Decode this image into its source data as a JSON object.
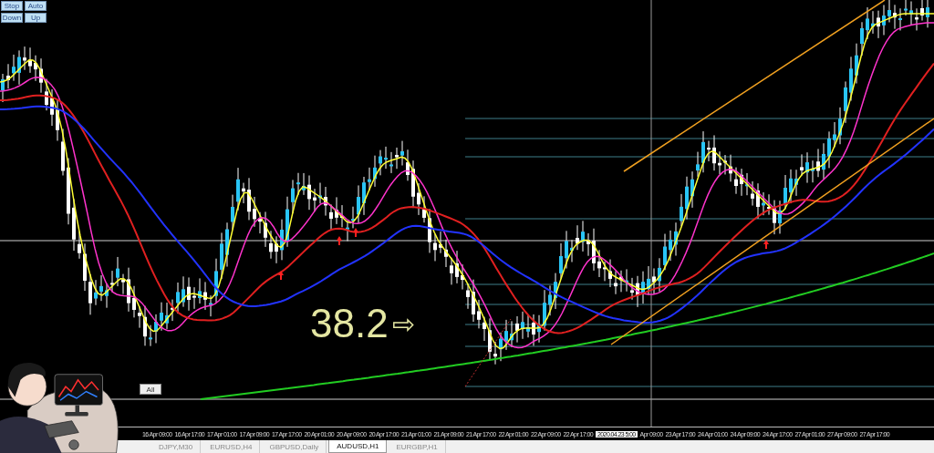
{
  "toolbar_buttons": [
    {
      "label": "Stop"
    },
    {
      "label": "Auto"
    },
    {
      "label": "Down"
    },
    {
      "label": "Up"
    }
  ],
  "overlay_button": {
    "label": "All"
  },
  "annotation": {
    "text": "38.2",
    "arrow": "⇨"
  },
  "time_axis": [
    {
      "kind": "time",
      "label": "16 Apr 09:00"
    },
    {
      "kind": "time",
      "label": "16 Apr 17:00"
    },
    {
      "kind": "time",
      "label": "17 Apr 01:00"
    },
    {
      "kind": "time",
      "label": "17 Apr 09:00"
    },
    {
      "kind": "time",
      "label": "17 Apr 17:00"
    },
    {
      "kind": "time",
      "label": "20 Apr 01:00"
    },
    {
      "kind": "time",
      "label": "20 Apr 09:00"
    },
    {
      "kind": "time",
      "label": "20 Apr 17:00"
    },
    {
      "kind": "time",
      "label": "21 Apr 01:00"
    },
    {
      "kind": "time",
      "label": "21 Apr 09:00"
    },
    {
      "kind": "time",
      "label": "21 Apr 17:00"
    },
    {
      "kind": "time",
      "label": "22 Apr 01:00"
    },
    {
      "kind": "time",
      "label": "22 Apr 09:00"
    },
    {
      "kind": "time",
      "label": "22 Apr 17:00"
    },
    {
      "kind": "cursor",
      "label": "2020.04.23 5:00"
    },
    {
      "kind": "time",
      "label": "Apr 09:00"
    },
    {
      "kind": "time",
      "label": "23 Apr 17:00"
    },
    {
      "kind": "time",
      "label": "24 Apr 01:00"
    },
    {
      "kind": "time",
      "label": "24 Apr 09:00"
    },
    {
      "kind": "time",
      "label": "24 Apr 17:00"
    },
    {
      "kind": "time",
      "label": "27 Apr 01:00"
    },
    {
      "kind": "time",
      "label": "27 Apr 09:00"
    },
    {
      "kind": "time",
      "label": "27 Apr 17:00"
    }
  ],
  "tabs": [
    {
      "label": "DJPY,M30",
      "selected": false
    },
    {
      "label": "EURUSD,H4",
      "selected": false
    },
    {
      "label": "GBPUSD,Daily",
      "selected": false
    },
    {
      "label": "AUDUSD,H1",
      "selected": true
    },
    {
      "label": "EURGBP,H1",
      "selected": false
    }
  ]
}
